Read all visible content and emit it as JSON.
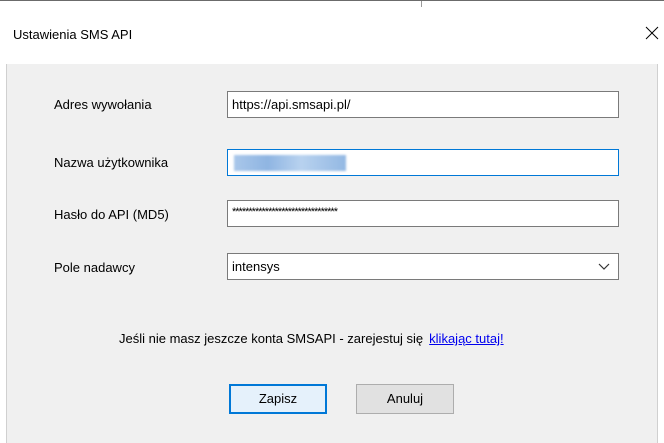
{
  "window": {
    "title": "Ustawienia SMS API",
    "close_glyph": "✕"
  },
  "form": {
    "address": {
      "label": "Adres wywołania",
      "value": "https://api.smsapi.pl/"
    },
    "username": {
      "label": "Nazwa użytkownika",
      "value": ""
    },
    "password": {
      "label": "Hasło do API (MD5)",
      "value": "********************************"
    },
    "sender": {
      "label": "Pole nadawcy",
      "value": "intensys"
    }
  },
  "info": {
    "text": "Jeśli nie masz jeszcze konta SMSAPI - zarejestuj się",
    "link_text": "klikając tutaj!"
  },
  "buttons": {
    "save": "Zapisz",
    "cancel": "Anuluj"
  },
  "colors": {
    "accent": "#0078d7",
    "link": "#0000ee",
    "client_bg": "#f0f0f0"
  }
}
